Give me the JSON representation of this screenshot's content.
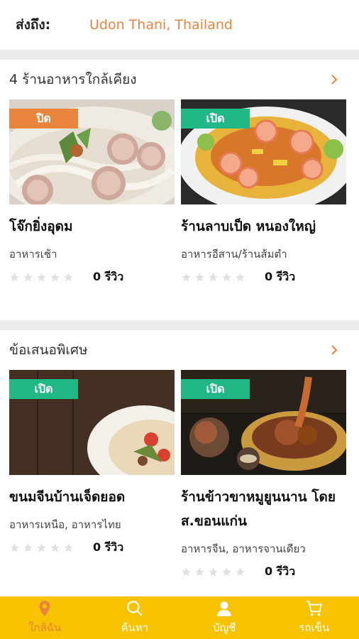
{
  "header": {
    "label": "ส่งถึง:",
    "location": "Udon Thani, Thailand"
  },
  "sections": [
    {
      "title": "4 ร้านอาหารใกล้เคียง",
      "cards": [
        {
          "badge": "ปิด",
          "badge_color": "#e8843c",
          "name": "โจ๊กยิ่งอุดม",
          "category": "อาหารเช้า",
          "rating": 0,
          "reviews": "0 รีวิว"
        },
        {
          "badge": "เปิด",
          "badge_color": "#1fb886",
          "name": "ร้านลาบเป็ด หนองใหญ่",
          "category": "อาหารอีสาน/ร้านส้มตำ",
          "rating": 0,
          "reviews": "0 รีวิว"
        }
      ]
    },
    {
      "title": "ข้อเสนอพิเศษ",
      "cards": [
        {
          "badge": "เปิด",
          "badge_color": "#1fb886",
          "name": "ขนมจีนบ้านเจ็ดยอด",
          "category": "อาหารเหนือ, อาหารไทย",
          "rating": 0,
          "reviews": "0 รีวิว"
        },
        {
          "badge": "เปิด",
          "badge_color": "#1fb886",
          "name": "ร้านข้าวขาหมูยูนนาน โดย ส.ขอนแก่น",
          "category": "อาหารจีน, อาหารจานเดียว",
          "rating": 0,
          "reviews": "0 รีวิว"
        }
      ]
    }
  ],
  "nav": [
    {
      "label": "ใกล้ฉัน",
      "icon": "location-pin-icon",
      "active": true
    },
    {
      "label": "ค้นหา",
      "icon": "search-icon",
      "active": false
    },
    {
      "label": "บัญชี",
      "icon": "account-icon",
      "active": false
    },
    {
      "label": "รถเข็น",
      "icon": "cart-icon",
      "active": false
    }
  ],
  "colors": {
    "accent": "#e8843c",
    "open": "#1fb886",
    "nav_bg": "#f7c300"
  }
}
